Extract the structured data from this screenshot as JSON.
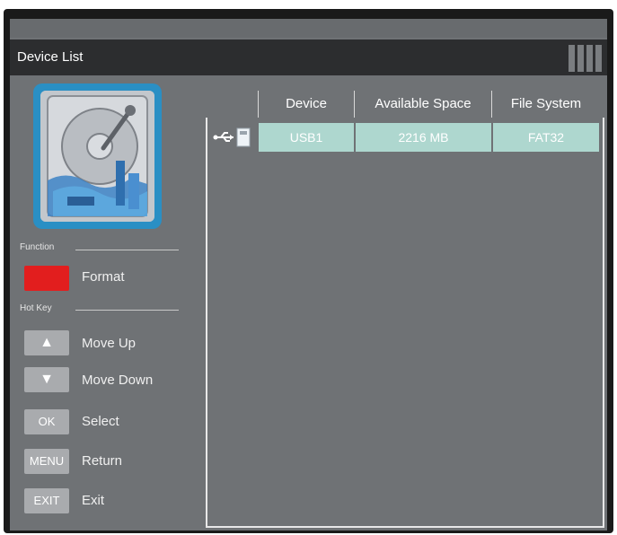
{
  "window": {
    "title": "Device List"
  },
  "table": {
    "headers": {
      "device": "Device",
      "available": "Available Space",
      "filesystem": "File System"
    },
    "rows": [
      {
        "device": "USB1",
        "available": "2216 MB",
        "filesystem": "FAT32"
      }
    ]
  },
  "sidebar": {
    "function_label": "Function",
    "hotkey_label": "Hot Key",
    "function_items": [
      {
        "key": "",
        "color": "#e21e1e",
        "label": "Format"
      }
    ],
    "hotkeys": [
      {
        "key": "▲",
        "label": "Move Up"
      },
      {
        "key": "▼",
        "label": "Move Down"
      },
      {
        "key": "OK",
        "label": "Select"
      },
      {
        "key": "MENU",
        "label": "Return"
      },
      {
        "key": "EXIT",
        "label": "Exit"
      }
    ]
  },
  "icons": {
    "hdd": "hard-drive-icon",
    "usb": "usb-icon",
    "signal": "signal-bars-icon"
  }
}
